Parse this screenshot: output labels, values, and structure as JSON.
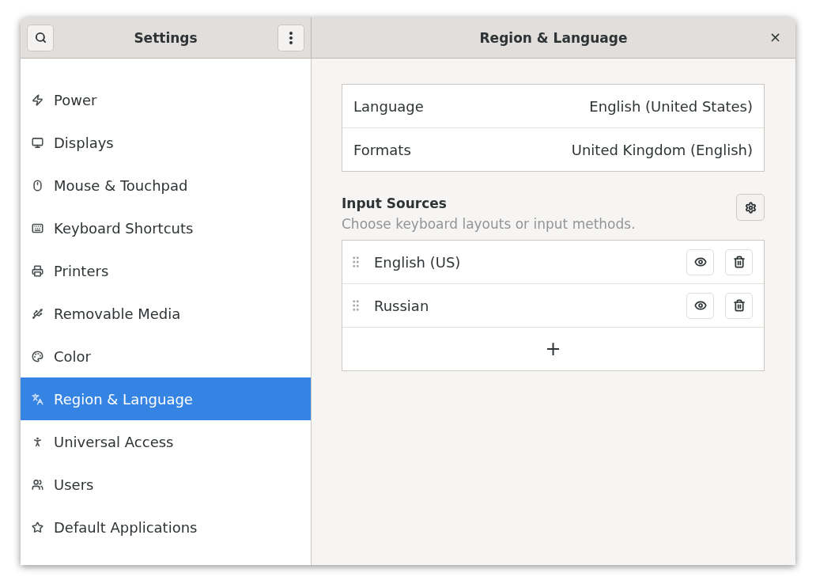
{
  "sidebar": {
    "title": "Settings",
    "items": [
      {
        "label": "Power",
        "selected": false
      },
      {
        "label": "Displays",
        "selected": false
      },
      {
        "label": "Mouse & Touchpad",
        "selected": false
      },
      {
        "label": "Keyboard Shortcuts",
        "selected": false
      },
      {
        "label": "Printers",
        "selected": false
      },
      {
        "label": "Removable Media",
        "selected": false
      },
      {
        "label": "Color",
        "selected": false
      },
      {
        "label": "Region & Language",
        "selected": true
      },
      {
        "label": "Universal Access",
        "selected": false
      },
      {
        "label": "Users",
        "selected": false
      },
      {
        "label": "Default Applications",
        "selected": false
      }
    ]
  },
  "panel": {
    "title": "Region & Language",
    "close": "×",
    "settings": [
      {
        "label": "Language",
        "value": "English (United States)"
      },
      {
        "label": "Formats",
        "value": "United Kingdom (English)"
      }
    ],
    "input_sources": {
      "title": "Input Sources",
      "subtitle": "Choose keyboard layouts or input methods.",
      "sources": [
        {
          "name": "English (US)"
        },
        {
          "name": "Russian"
        }
      ],
      "add": "+"
    }
  }
}
